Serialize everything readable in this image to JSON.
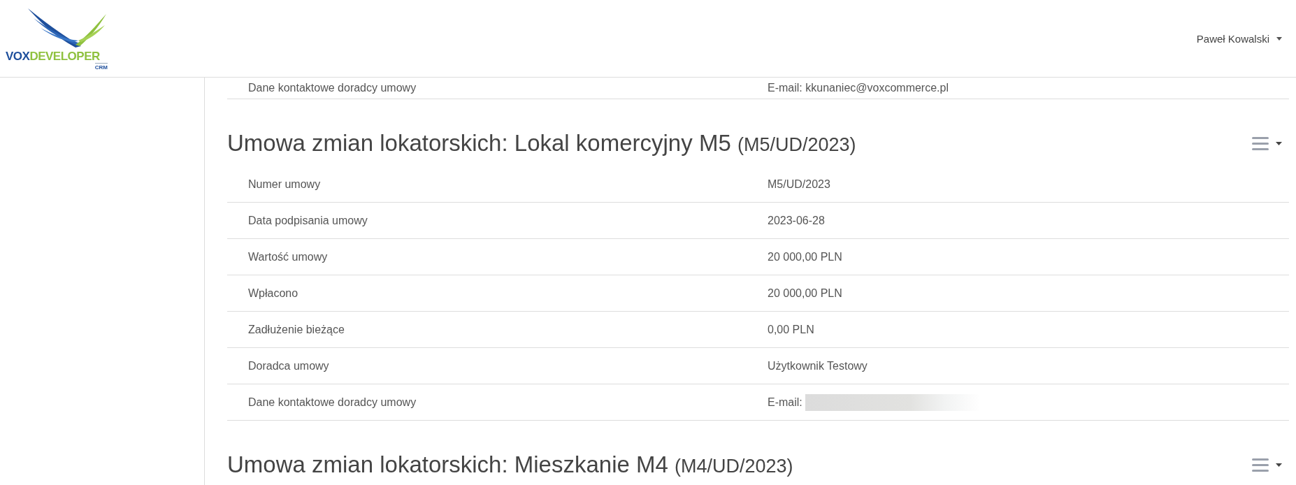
{
  "logo": {
    "first": "VOX",
    "second": "DEVELOPER",
    "suffix": "CRM"
  },
  "user_menu": {
    "label": "Paweł Kowalski"
  },
  "top_rows": [
    {
      "label": "Dane kontaktowe doradcy umowy",
      "value": "E-mail: kkunaniec@voxcommerce.pl",
      "redacted": false
    }
  ],
  "contracts": [
    {
      "title": "Umowa zmian lokatorskich: Lokal komercyjny M5",
      "number": "(M5/UD/2023)",
      "rows": [
        {
          "label": "Numer umowy",
          "value": "M5/UD/2023",
          "redacted": false
        },
        {
          "label": "Data podpisania umowy",
          "value": "2023-06-28",
          "redacted": false
        },
        {
          "label": "Wartość umowy",
          "value": "20 000,00 PLN",
          "redacted": false
        },
        {
          "label": "Wpłacono",
          "value": "20 000,00 PLN",
          "redacted": false
        },
        {
          "label": "Zadłużenie bieżące",
          "value": "0,00 PLN",
          "redacted": false
        },
        {
          "label": "Doradca umowy",
          "value": "Użytkownik Testowy",
          "redacted": false
        },
        {
          "label": "Dane kontaktowe doradcy umowy",
          "value": "E-mail:",
          "redacted": true
        }
      ]
    },
    {
      "title": "Umowa zmian lokatorskich: Mieszkanie M4",
      "number": "(M4/UD/2023)"
    }
  ]
}
